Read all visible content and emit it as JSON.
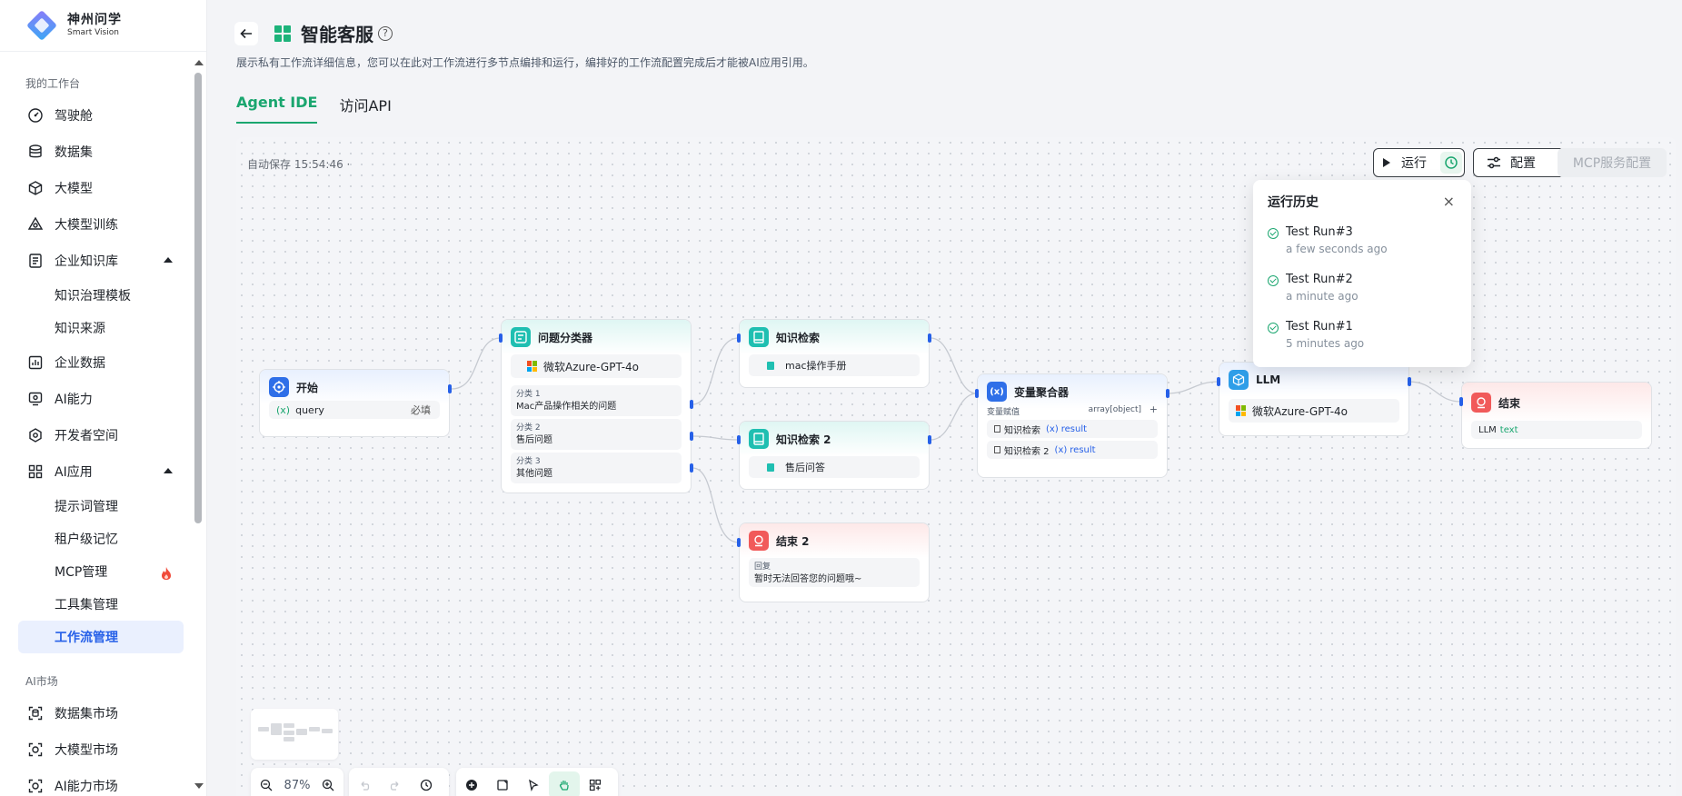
{
  "brand": {
    "name_cn": "神州问学",
    "name_en": "Smart Vision"
  },
  "sidebar": {
    "section1": "我的工作台",
    "items": [
      {
        "label": "驾驶舱",
        "icon": "dashboard-icon"
      },
      {
        "label": "数据集",
        "icon": "database-icon"
      },
      {
        "label": "大模型",
        "icon": "cube-icon"
      },
      {
        "label": "大模型训练",
        "icon": "training-icon"
      },
      {
        "label": "企业知识库",
        "icon": "knowledge-icon",
        "expanded": true,
        "children": [
          "知识治理模板",
          "知识来源"
        ]
      },
      {
        "label": "企业数据",
        "icon": "chart-icon"
      },
      {
        "label": "AI能力",
        "icon": "ai-ability-icon"
      },
      {
        "label": "开发者空间",
        "icon": "developer-icon"
      },
      {
        "label": "AI应用",
        "icon": "app-grid-icon",
        "expanded": true,
        "children": [
          "提示词管理",
          "租户级记忆",
          "MCP管理",
          "工具集管理",
          "工作流管理"
        ]
      }
    ],
    "section2": "AI市场",
    "market": [
      {
        "label": "数据集市场",
        "icon": "dataset-market-icon"
      },
      {
        "label": "大模型市场",
        "icon": "model-market-icon"
      },
      {
        "label": "AI能力市场",
        "icon": "ability-market-icon"
      }
    ],
    "active": "工作流管理",
    "hot_item": "MCP管理"
  },
  "header": {
    "title": "智能客服",
    "help": "?",
    "description": "展示私有工作流详细信息，您可以在此对工作流进行多节点编排和运行，编排好的工作流配置完成后才能被AI应用引用。",
    "tabs": [
      "Agent IDE",
      "访问API"
    ],
    "active_tab": "Agent IDE"
  },
  "canvas": {
    "autosave": "自动保存 15:54:46 ·",
    "run_label": "运行",
    "config_label": "配置",
    "mcp_label": "MCP服务配置",
    "zoom": "87%"
  },
  "history": {
    "title": "运行历史",
    "close": "×",
    "runs": [
      {
        "name": "Test Run#3",
        "time": "a few seconds ago"
      },
      {
        "name": "Test Run#2",
        "time": "a minute ago"
      },
      {
        "name": "Test Run#1",
        "time": "5 minutes ago"
      }
    ]
  },
  "nodes": {
    "start": {
      "title": "开始",
      "var_icon": "(x)",
      "var": "query",
      "required": "必填"
    },
    "classifier": {
      "title": "问题分类器",
      "model": "微软Azure-GPT-4o",
      "classes": [
        {
          "key": "分类 1",
          "text": "Mac产品操作相关的问题"
        },
        {
          "key": "分类 2",
          "text": "售后问题"
        },
        {
          "key": "分类 3",
          "text": "其他问题"
        }
      ]
    },
    "kb1": {
      "title": "知识检索",
      "item": "mac操作手册"
    },
    "kb2": {
      "title": "知识检索 2",
      "item": "售后问答"
    },
    "end2": {
      "title": "结束 2",
      "key": "回复",
      "text": "暂时无法回答您的问题哦~"
    },
    "aggregator": {
      "title": "变量聚合器",
      "key": "变量赋值",
      "type": "array[object]",
      "plus": "+",
      "rows": [
        {
          "src": "知识检索",
          "var_icon": "(x)",
          "var": "result"
        },
        {
          "src": "知识检索 2",
          "var_icon": "(x)",
          "var": "result"
        }
      ]
    },
    "llm": {
      "title": "LLM",
      "model": "微软Azure-GPT-4o"
    },
    "end": {
      "title": "结束",
      "src": "LLM",
      "var": "text"
    }
  },
  "colors": {
    "accent": "#1aa66f",
    "primary": "#2660e8",
    "danger": "#f15a5a",
    "teal": "#1fbfb1"
  }
}
